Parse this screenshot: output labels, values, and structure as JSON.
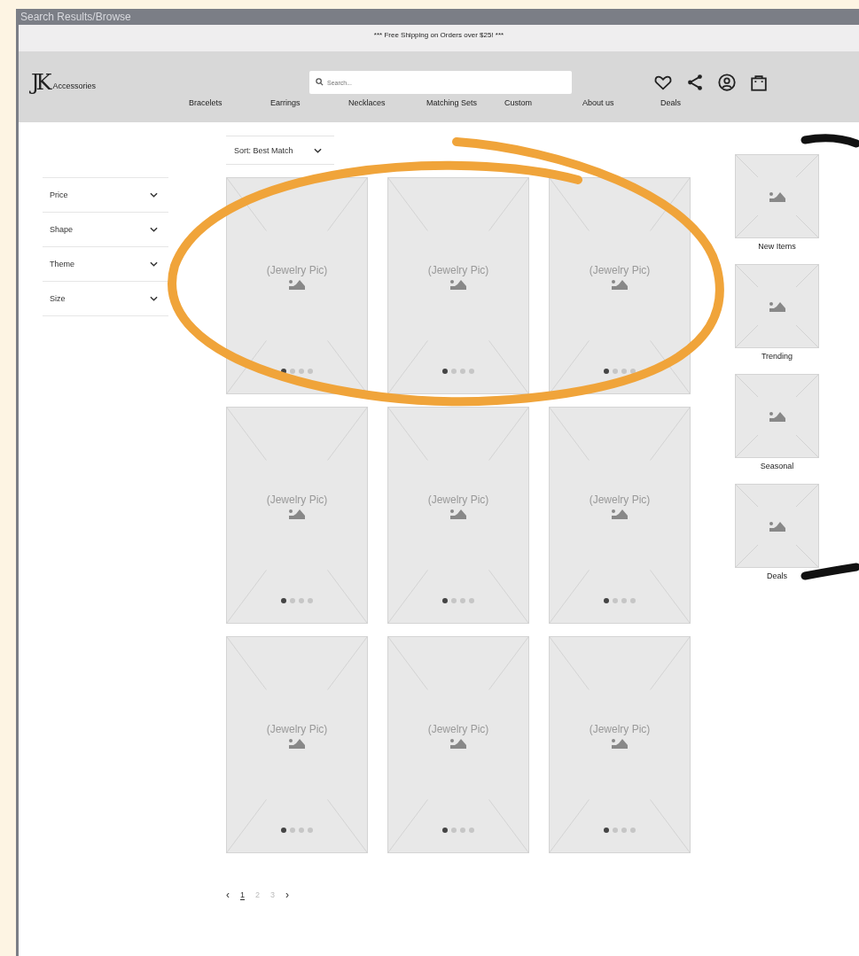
{
  "window": {
    "title": "Search Results/Browse"
  },
  "banner": "*** Free Shipping on Orders over $25! ***",
  "header": {
    "logo_mark": "JK",
    "logo_text": "Accessories",
    "search": {
      "placeholder": "Search..."
    }
  },
  "nav": [
    "Bracelets",
    "Earrings",
    "Necklaces",
    "Matching Sets",
    "Custom",
    "About us",
    "Deals"
  ],
  "filters": [
    "Price",
    "Shape",
    "Theme",
    "Size"
  ],
  "sort": "Sort: Best Match",
  "products": [
    {
      "caption": "(Jewelry Pic)",
      "dots": [
        {
          "selected": true
        },
        {
          "selected": false
        },
        {
          "selected": false
        },
        {
          "selected": false
        }
      ]
    },
    {
      "caption": "(Jewelry Pic)",
      "dots": [
        {
          "selected": true
        },
        {
          "selected": false
        },
        {
          "selected": false
        },
        {
          "selected": false
        }
      ]
    },
    {
      "caption": "(Jewelry Pic)",
      "dots": [
        {
          "selected": true
        },
        {
          "selected": false
        },
        {
          "selected": false
        },
        {
          "selected": false
        }
      ]
    },
    {
      "caption": "(Jewelry Pic)",
      "dots": [
        {
          "selected": true
        },
        {
          "selected": false
        },
        {
          "selected": false
        },
        {
          "selected": false
        }
      ]
    },
    {
      "caption": "(Jewelry Pic)",
      "dots": [
        {
          "selected": true
        },
        {
          "selected": false
        },
        {
          "selected": false
        },
        {
          "selected": false
        }
      ]
    },
    {
      "caption": "(Jewelry Pic)",
      "dots": [
        {
          "selected": true
        },
        {
          "selected": false
        },
        {
          "selected": false
        },
        {
          "selected": false
        }
      ]
    },
    {
      "caption": "(Jewelry Pic)",
      "dots": [
        {
          "selected": true
        },
        {
          "selected": false
        },
        {
          "selected": false
        },
        {
          "selected": false
        }
      ]
    },
    {
      "caption": "(Jewelry Pic)",
      "dots": [
        {
          "selected": true
        },
        {
          "selected": false
        },
        {
          "selected": false
        },
        {
          "selected": false
        }
      ]
    },
    {
      "caption": "(Jewelry Pic)",
      "dots": [
        {
          "selected": true
        },
        {
          "selected": false
        },
        {
          "selected": false
        },
        {
          "selected": false
        }
      ]
    }
  ],
  "categories": [
    "New Items",
    "Trending",
    "Seasonal",
    "Deals"
  ],
  "pagination": {
    "prev": "‹",
    "next": "›",
    "pages": [
      {
        "label": "1",
        "selected": true
      },
      {
        "label": "2",
        "selected": false
      },
      {
        "label": "3",
        "selected": false
      }
    ]
  }
}
